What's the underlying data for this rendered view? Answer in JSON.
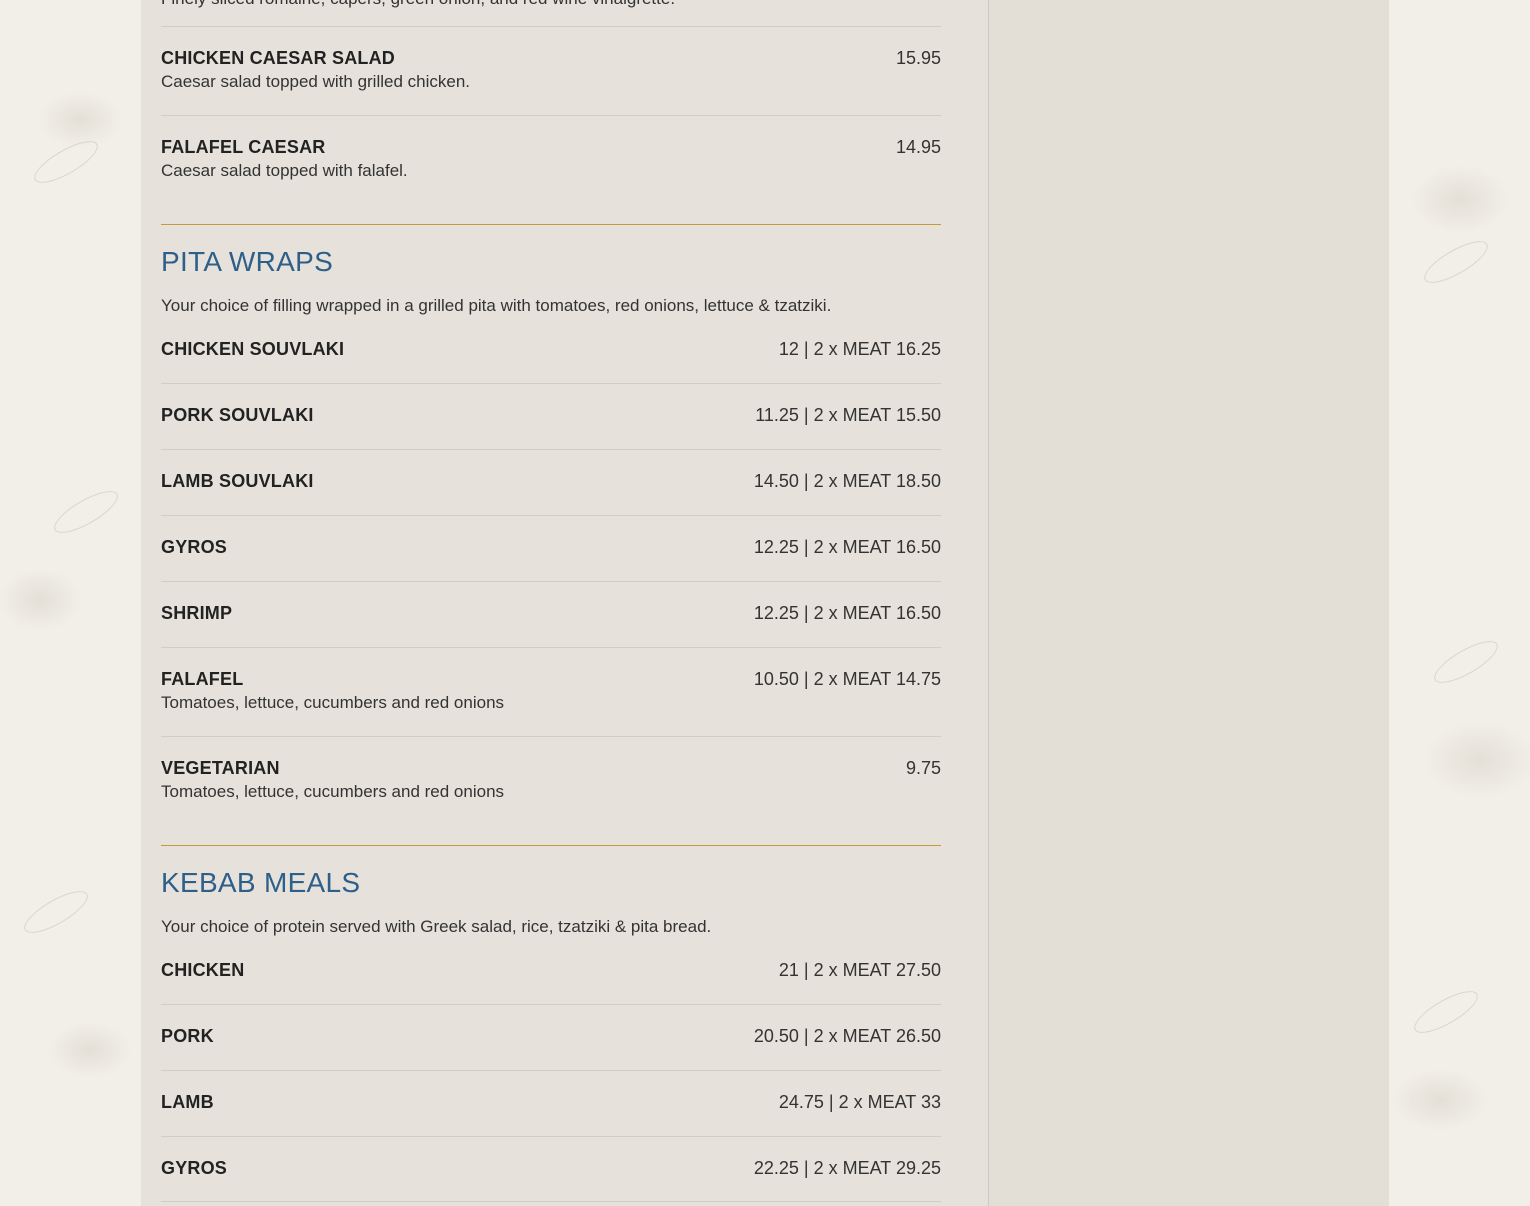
{
  "truncated_line": "Finely sliced romaine, capers, green onion, and red wine vinaigrette.",
  "salads": [
    {
      "name": "CHICKEN CAESAR SALAD",
      "price": "15.95",
      "desc": "Caesar salad topped with grilled chicken."
    },
    {
      "name": "FALAFEL CAESAR",
      "price": "14.95",
      "desc": "Caesar salad topped with falafel."
    }
  ],
  "pita": {
    "heading": "PITA WRAPS",
    "intro": "Your choice of filling wrapped in a grilled pita with tomatoes, red onions, lettuce & tzatziki.",
    "items": [
      {
        "name": "CHICKEN SOUVLAKI",
        "price": "12 | 2 x MEAT 16.25",
        "desc": ""
      },
      {
        "name": "PORK SOUVLAKI",
        "price": "11.25 | 2 x MEAT 15.50",
        "desc": ""
      },
      {
        "name": "LAMB SOUVLAKI",
        "price": "14.50 | 2 x MEAT 18.50",
        "desc": ""
      },
      {
        "name": "GYROS",
        "price": "12.25 | 2 x MEAT 16.50",
        "desc": ""
      },
      {
        "name": "SHRIMP",
        "price": "12.25 | 2 x MEAT 16.50",
        "desc": ""
      },
      {
        "name": "FALAFEL",
        "price": "10.50 | 2 x MEAT 14.75",
        "desc": "Tomatoes, lettuce, cucumbers and red onions"
      },
      {
        "name": "VEGETARIAN",
        "price": "9.75",
        "desc": "Tomatoes, lettuce, cucumbers and red onions"
      }
    ]
  },
  "kebab": {
    "heading": "KEBAB MEALS",
    "intro": "Your choice of protein served with Greek salad, rice, tzatziki & pita bread.",
    "items": [
      {
        "name": "CHICKEN",
        "price": "21 | 2 x MEAT 27.50",
        "desc": ""
      },
      {
        "name": "PORK",
        "price": "20.50 | 2 x MEAT 26.50",
        "desc": ""
      },
      {
        "name": "LAMB",
        "price": "24.75 | 2 x MEAT 33",
        "desc": ""
      },
      {
        "name": "GYROS",
        "price": "22.25 | 2 x MEAT 29.25",
        "desc": ""
      }
    ]
  },
  "colors": {
    "heading_blue": "#2e5f8a",
    "divider_gold": "#c49a3a",
    "panel_bg": "#e4e0d8"
  }
}
